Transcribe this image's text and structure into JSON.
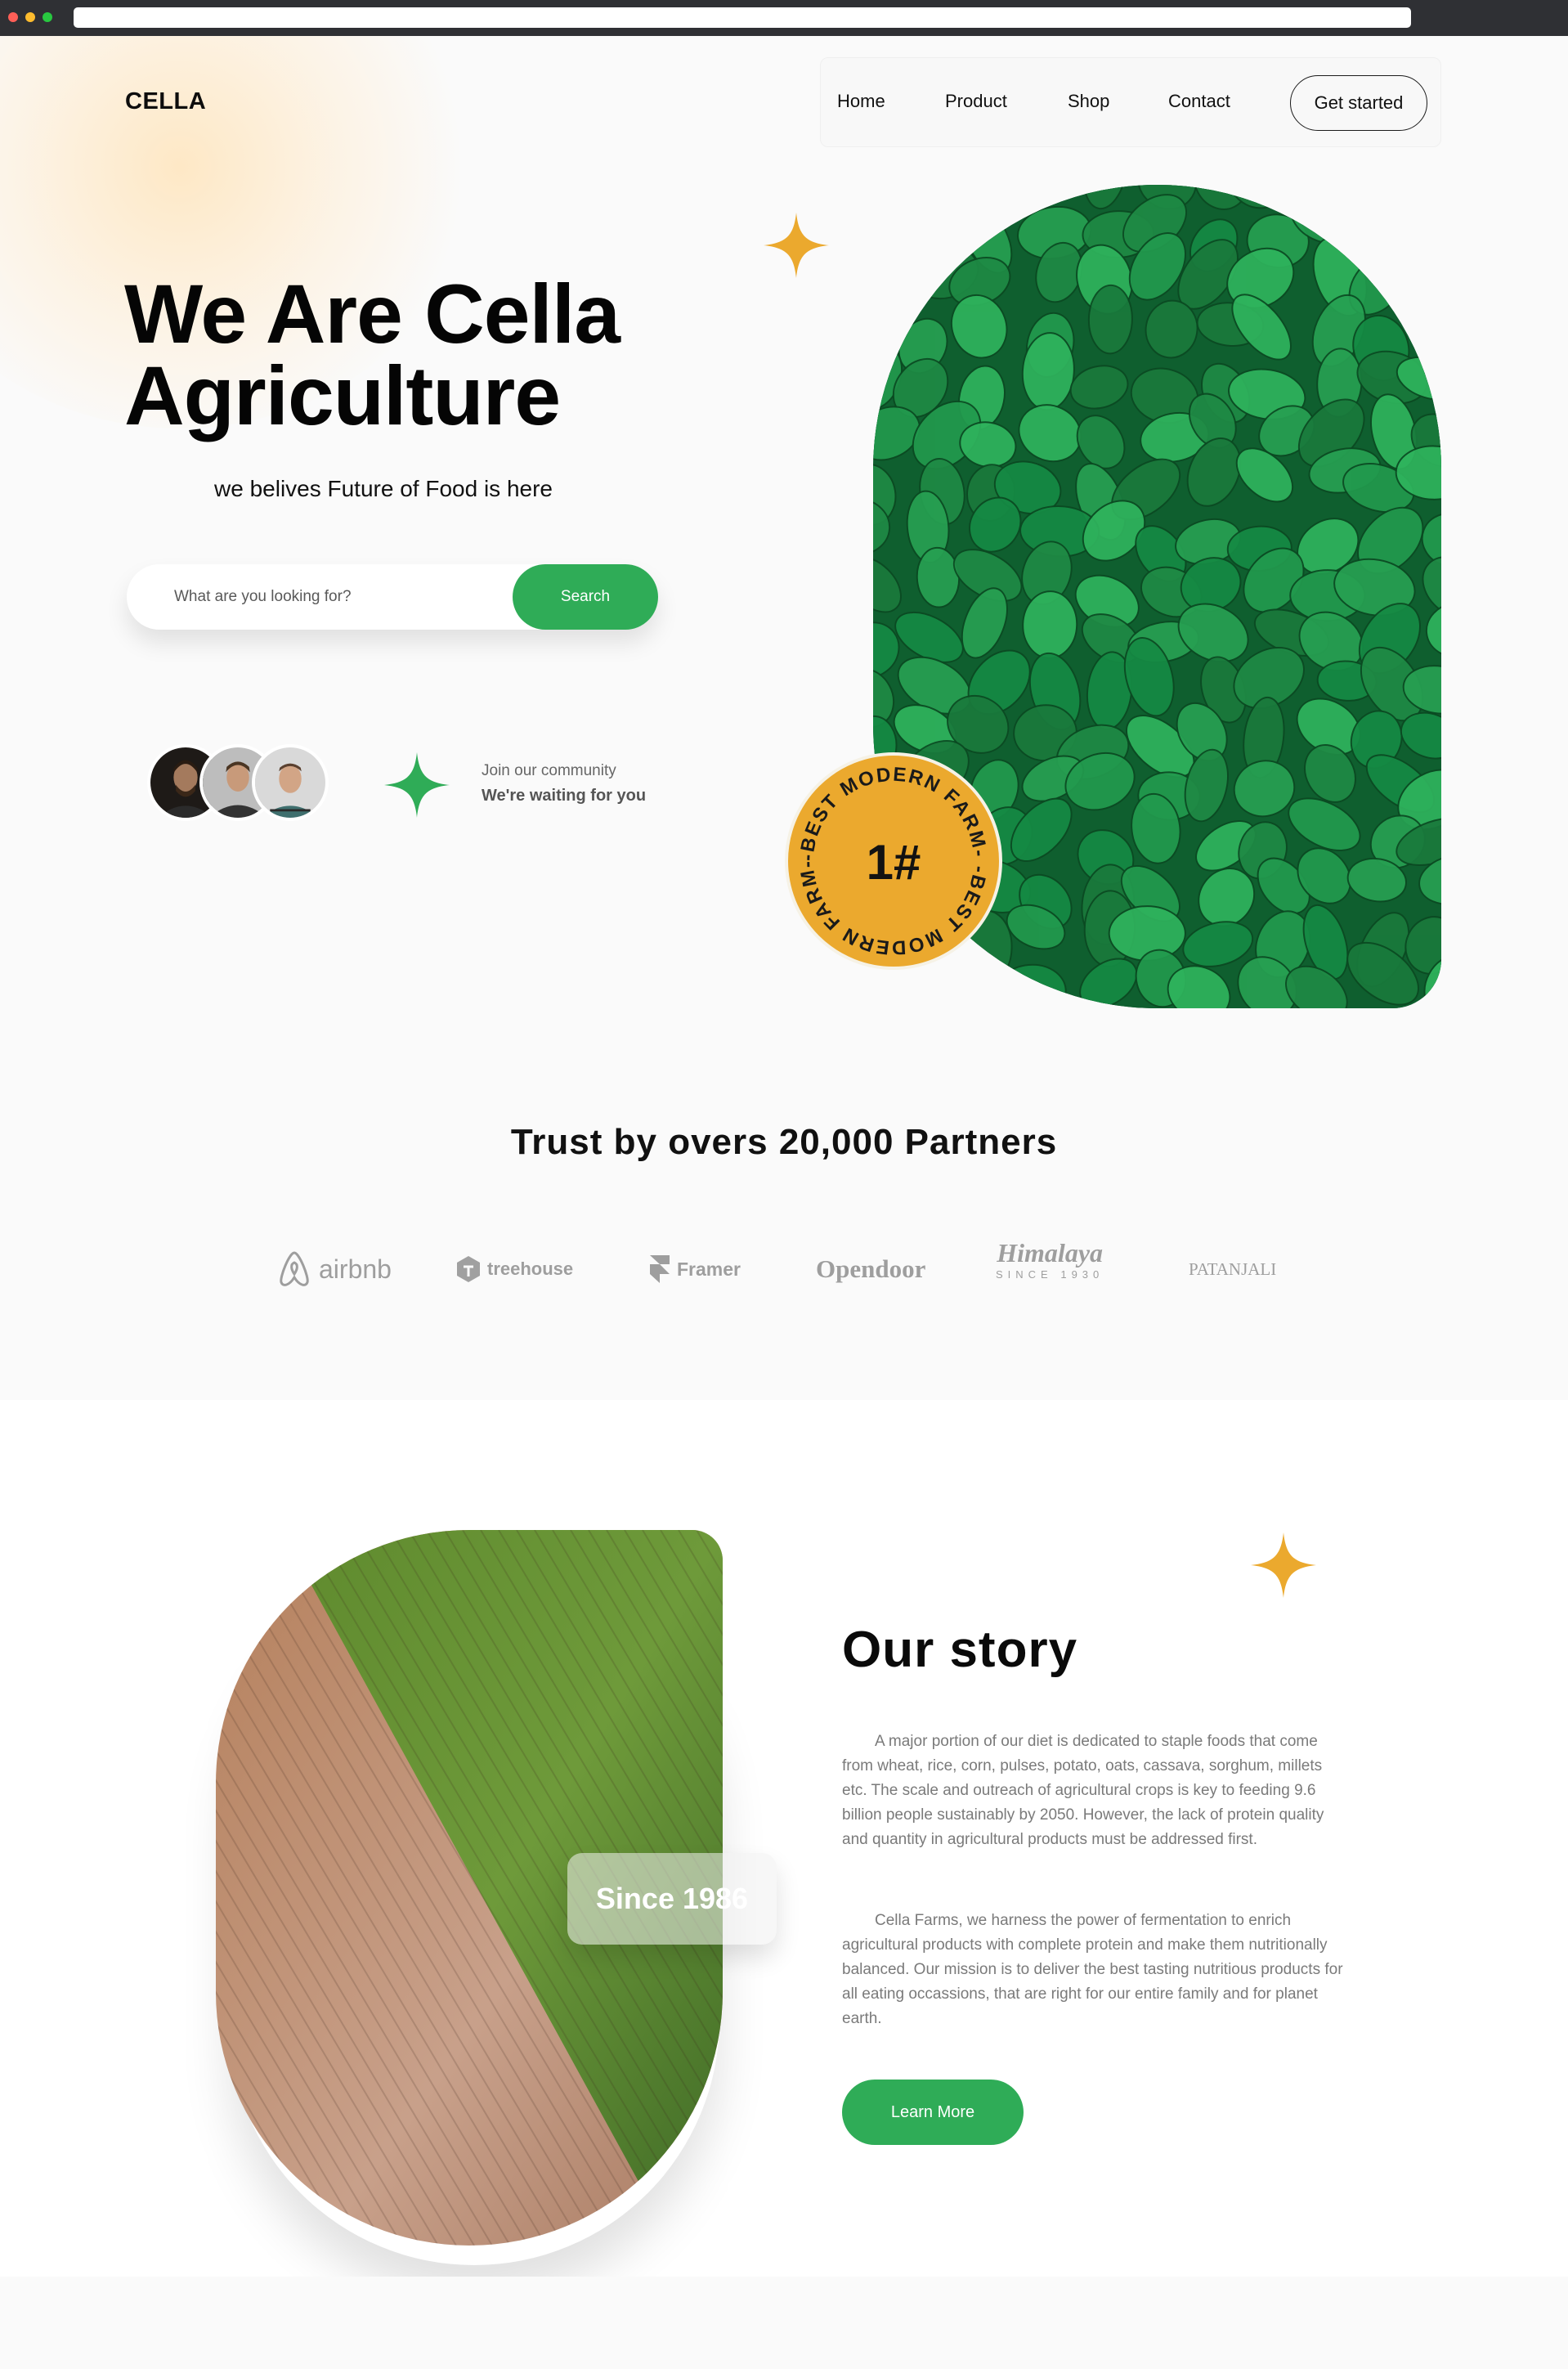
{
  "browser": {
    "url": ""
  },
  "brand": {
    "logo": "CELLA",
    "accent_green": "#2fac57",
    "accent_gold": "#eba92e"
  },
  "nav": {
    "items": [
      "Home",
      "Product",
      "Shop",
      "Contact"
    ],
    "cta": "Get started"
  },
  "hero": {
    "title_line1": "We Are Cella",
    "title_line2": "Agriculture",
    "subtitle": "we belives Future of Food is here",
    "search": {
      "placeholder": "What are you looking for?",
      "button": "Search"
    },
    "community": {
      "line1": "Join our community",
      "line2": "We're waiting for you"
    },
    "badge": {
      "number": "1#",
      "ring_text": "-BEST MODERN FARM- -BEST MODERN FARM-"
    }
  },
  "trust": {
    "title": "Trust by overs 20,000 Partners",
    "brands": [
      {
        "name": "airbnb",
        "icon": "airbnb-icon"
      },
      {
        "name": "treehouse",
        "icon": "treehouse-icon"
      },
      {
        "name": "Framer",
        "icon": "framer-icon"
      },
      {
        "name": "Opendoor",
        "icon": ""
      },
      {
        "name": "Himalaya",
        "sub": "SINCE 1930",
        "icon": ""
      },
      {
        "name": "PATANJALI",
        "icon": ""
      }
    ]
  },
  "story": {
    "title": "Our story",
    "since": "Since 1986",
    "paragraph1": "A major portion of our diet is dedicated to staple foods that come from wheat, rice, corn, pulses, potato, oats, cassava, sorghum, millets etc. The scale and outreach of agricultural crops is key to feeding 9.6 billion people sustainably by 2050. However, the lack of protein quality and quantity in agricultural products must be addressed first.",
    "paragraph2": "Cella Farms, we harness the power of fermentation to enrich agricultural products with complete protein and make them nutritionally balanced. Our mission is to deliver the best tasting nutritious products for all eating occassions, that are right for our entire family and for planet earth.",
    "button": "Learn More"
  }
}
